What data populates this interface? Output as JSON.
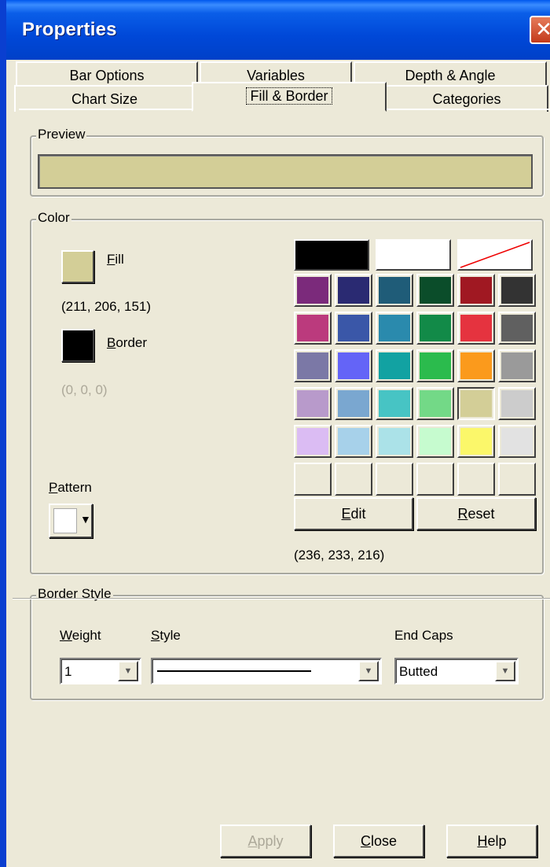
{
  "window": {
    "title": "Properties",
    "close_glyph": "✕"
  },
  "tabs": {
    "row_back": [
      "Bar Options",
      "Variables",
      "Depth & Angle"
    ],
    "row_front": [
      "Chart Size",
      "Fill & Border",
      "Categories"
    ],
    "active": "Fill & Border"
  },
  "preview": {
    "label": "Preview",
    "color": "#d3ce97"
  },
  "color_group": {
    "label": "Color",
    "fill_label_u": "F",
    "fill_label_rest": "ill",
    "fill_color": "#d3ce97",
    "fill_rgb": "(211, 206, 151)",
    "border_label_u": "B",
    "border_label_rest": "order",
    "border_color": "#000000",
    "border_rgb": "(0, 0, 0)",
    "pattern_label_u": "P",
    "pattern_label_rest": "attern",
    "palette_top": [
      "#000000",
      "#ffffff",
      "none"
    ],
    "palette": [
      [
        "#7b2a7b",
        "#2a2a72",
        "#1f5c78",
        "#0b4d2a",
        "#a01822",
        "#333333"
      ],
      [
        "#bb3a7d",
        "#3a57a8",
        "#2a8aad",
        "#128a48",
        "#e5333f",
        "#606060"
      ],
      [
        "#7b78a6",
        "#6464f7",
        "#12a2a2",
        "#2bbb4d",
        "#fb9a1c",
        "#9a9a9a"
      ],
      [
        "#b89acb",
        "#7aa7d0",
        "#47c4c4",
        "#73d987",
        "#d3ce97",
        "#cccccc"
      ],
      [
        "#dbbcf3",
        "#a7d1ea",
        "#abe2e8",
        "#c6fbcf",
        "#fbf76a",
        "#e2e2e2"
      ],
      [
        "#ece9d8",
        "#ece9d8",
        "#ece9d8",
        "#ece9d8",
        "#ece9d8",
        "#ece9d8"
      ]
    ],
    "selected_cell": [
      3,
      4
    ],
    "edit_u": "E",
    "edit_rest": "dit",
    "reset_u": "R",
    "reset_rest": "eset",
    "custom_rgb": "(236, 233, 216)"
  },
  "border_style": {
    "label": "Border Style",
    "weight_u": "W",
    "weight_rest": "eight",
    "weight_value": "1",
    "style_u": "S",
    "style_rest": "tyle",
    "endcaps_label": "End Caps",
    "endcaps_value": "Butted"
  },
  "buttons": {
    "apply_u": "A",
    "apply_rest": "pply",
    "close_u": "C",
    "close_rest": "lose",
    "help_u": "H",
    "help_rest": "elp"
  }
}
